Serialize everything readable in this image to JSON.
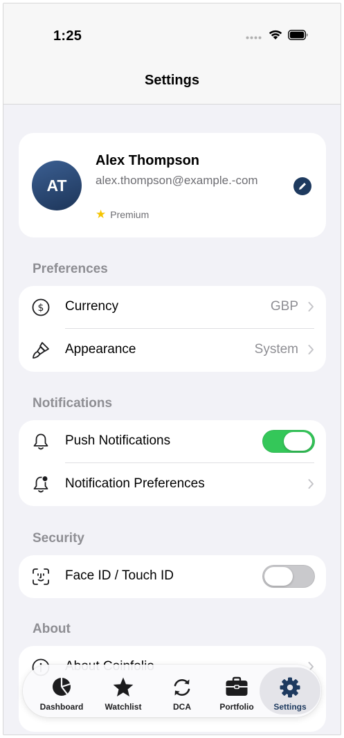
{
  "status_bar": {
    "time": "1:25"
  },
  "navbar": {
    "title": "Settings"
  },
  "profile": {
    "initials": "AT",
    "name": "Alex Thompson",
    "email": "alex.thompson@example.-com",
    "badge": "Premium"
  },
  "sections": {
    "preferences": {
      "title": "Preferences",
      "currency": {
        "label": "Currency",
        "value": "GBP"
      },
      "appearance": {
        "label": "Appearance",
        "value": "System"
      }
    },
    "notifications": {
      "title": "Notifications",
      "push": {
        "label": "Push Notifications",
        "enabled": true
      },
      "prefs": {
        "label": "Notification Preferences"
      }
    },
    "security": {
      "title": "Security",
      "faceid": {
        "label": "Face ID / Touch ID",
        "enabled": false
      }
    },
    "about": {
      "title": "About",
      "about_app": {
        "label": "About Coinfolio"
      }
    }
  },
  "tabbar": {
    "active": "Settings",
    "tabs": [
      {
        "label": "Dashboard",
        "icon": "pie-chart-icon"
      },
      {
        "label": "Watchlist",
        "icon": "star-icon"
      },
      {
        "label": "DCA",
        "icon": "refresh-icon"
      },
      {
        "label": "Portfolio",
        "icon": "briefcase-icon"
      },
      {
        "label": "Settings",
        "icon": "gear-icon"
      }
    ]
  },
  "colors": {
    "accent": "#1e3a5f",
    "toggle_on": "#34c759",
    "toggle_off": "#c9c9cc",
    "badge_star": "#f5c400",
    "background": "#f2f2f7"
  }
}
